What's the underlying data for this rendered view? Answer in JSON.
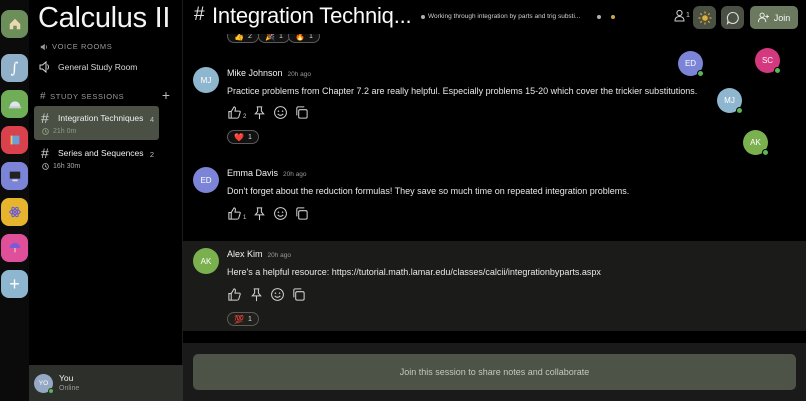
{
  "server": {
    "title": "Calculus II",
    "voice_section": "VOICE ROOMS",
    "voice_rooms": [
      "General Study Room"
    ],
    "study_section": "STUDY SESSIONS",
    "sessions": [
      {
        "name": "Integration Techniques",
        "count": "4",
        "time": "21h 0m",
        "active": true
      },
      {
        "name": "Series and Sequences",
        "count": "2",
        "time": "16h 30m",
        "active": false
      }
    ]
  },
  "rail": {
    "servers": [
      {
        "icon": "home-icon",
        "color": "#6b8e5a"
      },
      {
        "icon": "integral-icon",
        "label": "∫",
        "color": "#8fb0c8"
      },
      {
        "icon": "helmet-icon",
        "color": "#6fae57"
      },
      {
        "icon": "book-icon",
        "color": "#d9424c"
      },
      {
        "icon": "computer-icon",
        "color": "#7b84d6"
      },
      {
        "icon": "atom-icon",
        "color": "#e7b52d"
      },
      {
        "icon": "umbrella-icon",
        "color": "#e0509a"
      }
    ],
    "add_label": "+"
  },
  "user": {
    "initials": "YO",
    "name": "You",
    "status": "Online"
  },
  "header": {
    "hash": "#",
    "title": "Integration Techniq...",
    "topic": "Working through integration by parts and trig substi...",
    "online_count": "1",
    "join_label": "Join"
  },
  "messages": [
    {
      "initials": "MJ",
      "author": "Mike Johnson",
      "time": "20h ago",
      "color": "#8fb6cf",
      "text": "Practice problems from Chapter 7.2 are really helpful. Especially problems 15-20 which cover the trickier substitutions.",
      "likes": "2",
      "reaction": {
        "emoji": "❤️",
        "count": "1"
      }
    },
    {
      "initials": "ED",
      "author": "Emma Davis",
      "time": "20h ago",
      "color": "#7b84d6",
      "text": "Don't forget about the reduction formulas! They save so much time on repeated integration problems.",
      "likes": "1"
    },
    {
      "initials": "AK",
      "author": "Alex Kim",
      "time": "20h ago",
      "color": "#7bb04e",
      "text": "Here's a helpful resource: https://tutorial.math.lamar.edu/classes/calcii/integrationbyparts.aspx",
      "likes": "",
      "reaction": {
        "emoji": "💯",
        "count": "1"
      }
    }
  ],
  "top_reactions": [
    {
      "emoji": "👍",
      "count": "2"
    },
    {
      "emoji": "🎉",
      "count": "1"
    },
    {
      "emoji": "🔥",
      "count": "1"
    }
  ],
  "presence": [
    {
      "initials": "ED",
      "color": "#7b84d6"
    },
    {
      "initials": "SC",
      "color": "#d4397f"
    },
    {
      "initials": "MJ",
      "color": "#8fb6cf"
    },
    {
      "initials": "AK",
      "color": "#7bb04e"
    }
  ],
  "footer": {
    "join_prompt": "Join this session to share notes and collaborate"
  }
}
